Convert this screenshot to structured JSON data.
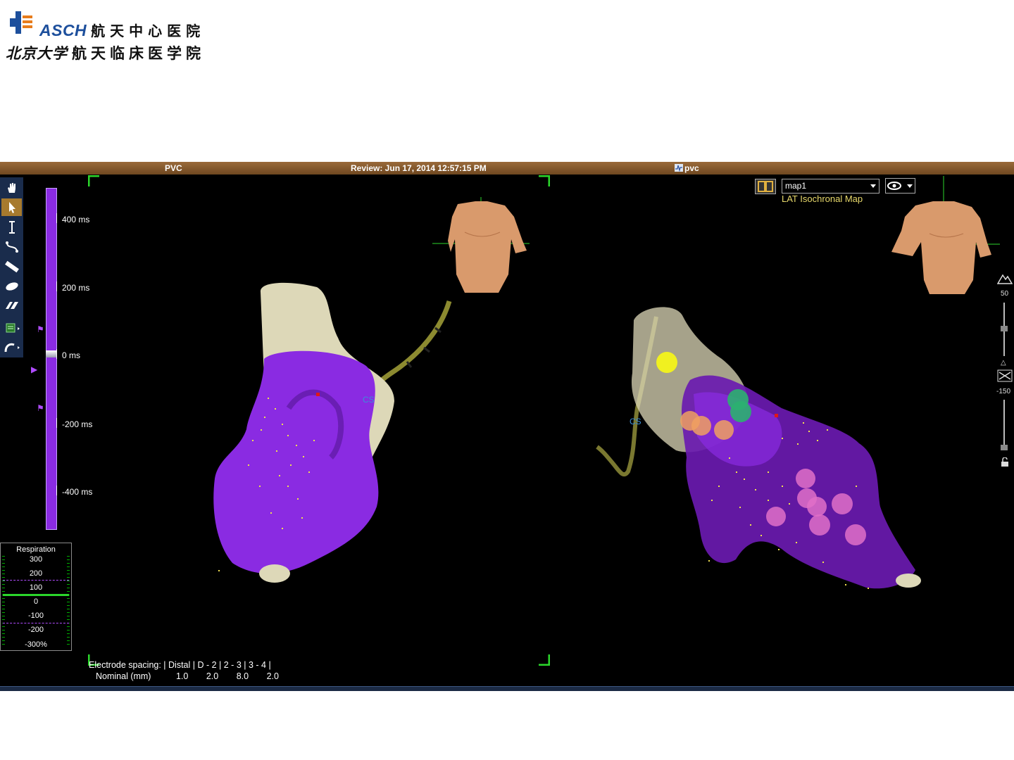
{
  "logo": {
    "abbr": "ASCH",
    "line1_cn": "航天中心医院",
    "line2_callig": "北京大学",
    "line2_rest": "航天临床医学院"
  },
  "titlebar": {
    "left": "PVC",
    "center": "Review: Jun 17, 2014 12:57:15 PM",
    "right": "pvc"
  },
  "toolbar": {
    "tools": [
      "hand-icon",
      "pointer-icon",
      "caliper-icon",
      "curve-icon",
      "ruler-icon",
      "ellipse-icon",
      "eraser-icon",
      "monitor-icon",
      "catheter-icon"
    ],
    "active": "pointer-icon"
  },
  "lat_scale": {
    "labels": [
      "400 ms",
      "200 ms",
      "0 ms",
      "-200 ms",
      "-400 ms"
    ],
    "color": "#8a2be2"
  },
  "respiration": {
    "title": "Respiration",
    "values": [
      "300",
      "200",
      "100",
      "0",
      "-100",
      "-200",
      "-300%"
    ]
  },
  "electrode": {
    "header": "Electrode spacing: | Distal | D - 2 | 2 - 3 | 3 - 4 |",
    "label": "Nominal (mm)",
    "values": [
      "1.0",
      "2.0",
      "8.0",
      "2.0"
    ]
  },
  "map_panel": {
    "selected_map": "map1",
    "map_type": "LAT Isochronal Map"
  },
  "right_controls": {
    "top_value": "50",
    "bottom_value": "-150"
  },
  "labels": {
    "cs_left": "CS",
    "cs_right": "CS"
  },
  "colors": {
    "titlebar": "#8a5a2c",
    "activation": "#8a2be2",
    "anatomy": "#ddd8b8",
    "toolbar": "#1a2c4c"
  }
}
